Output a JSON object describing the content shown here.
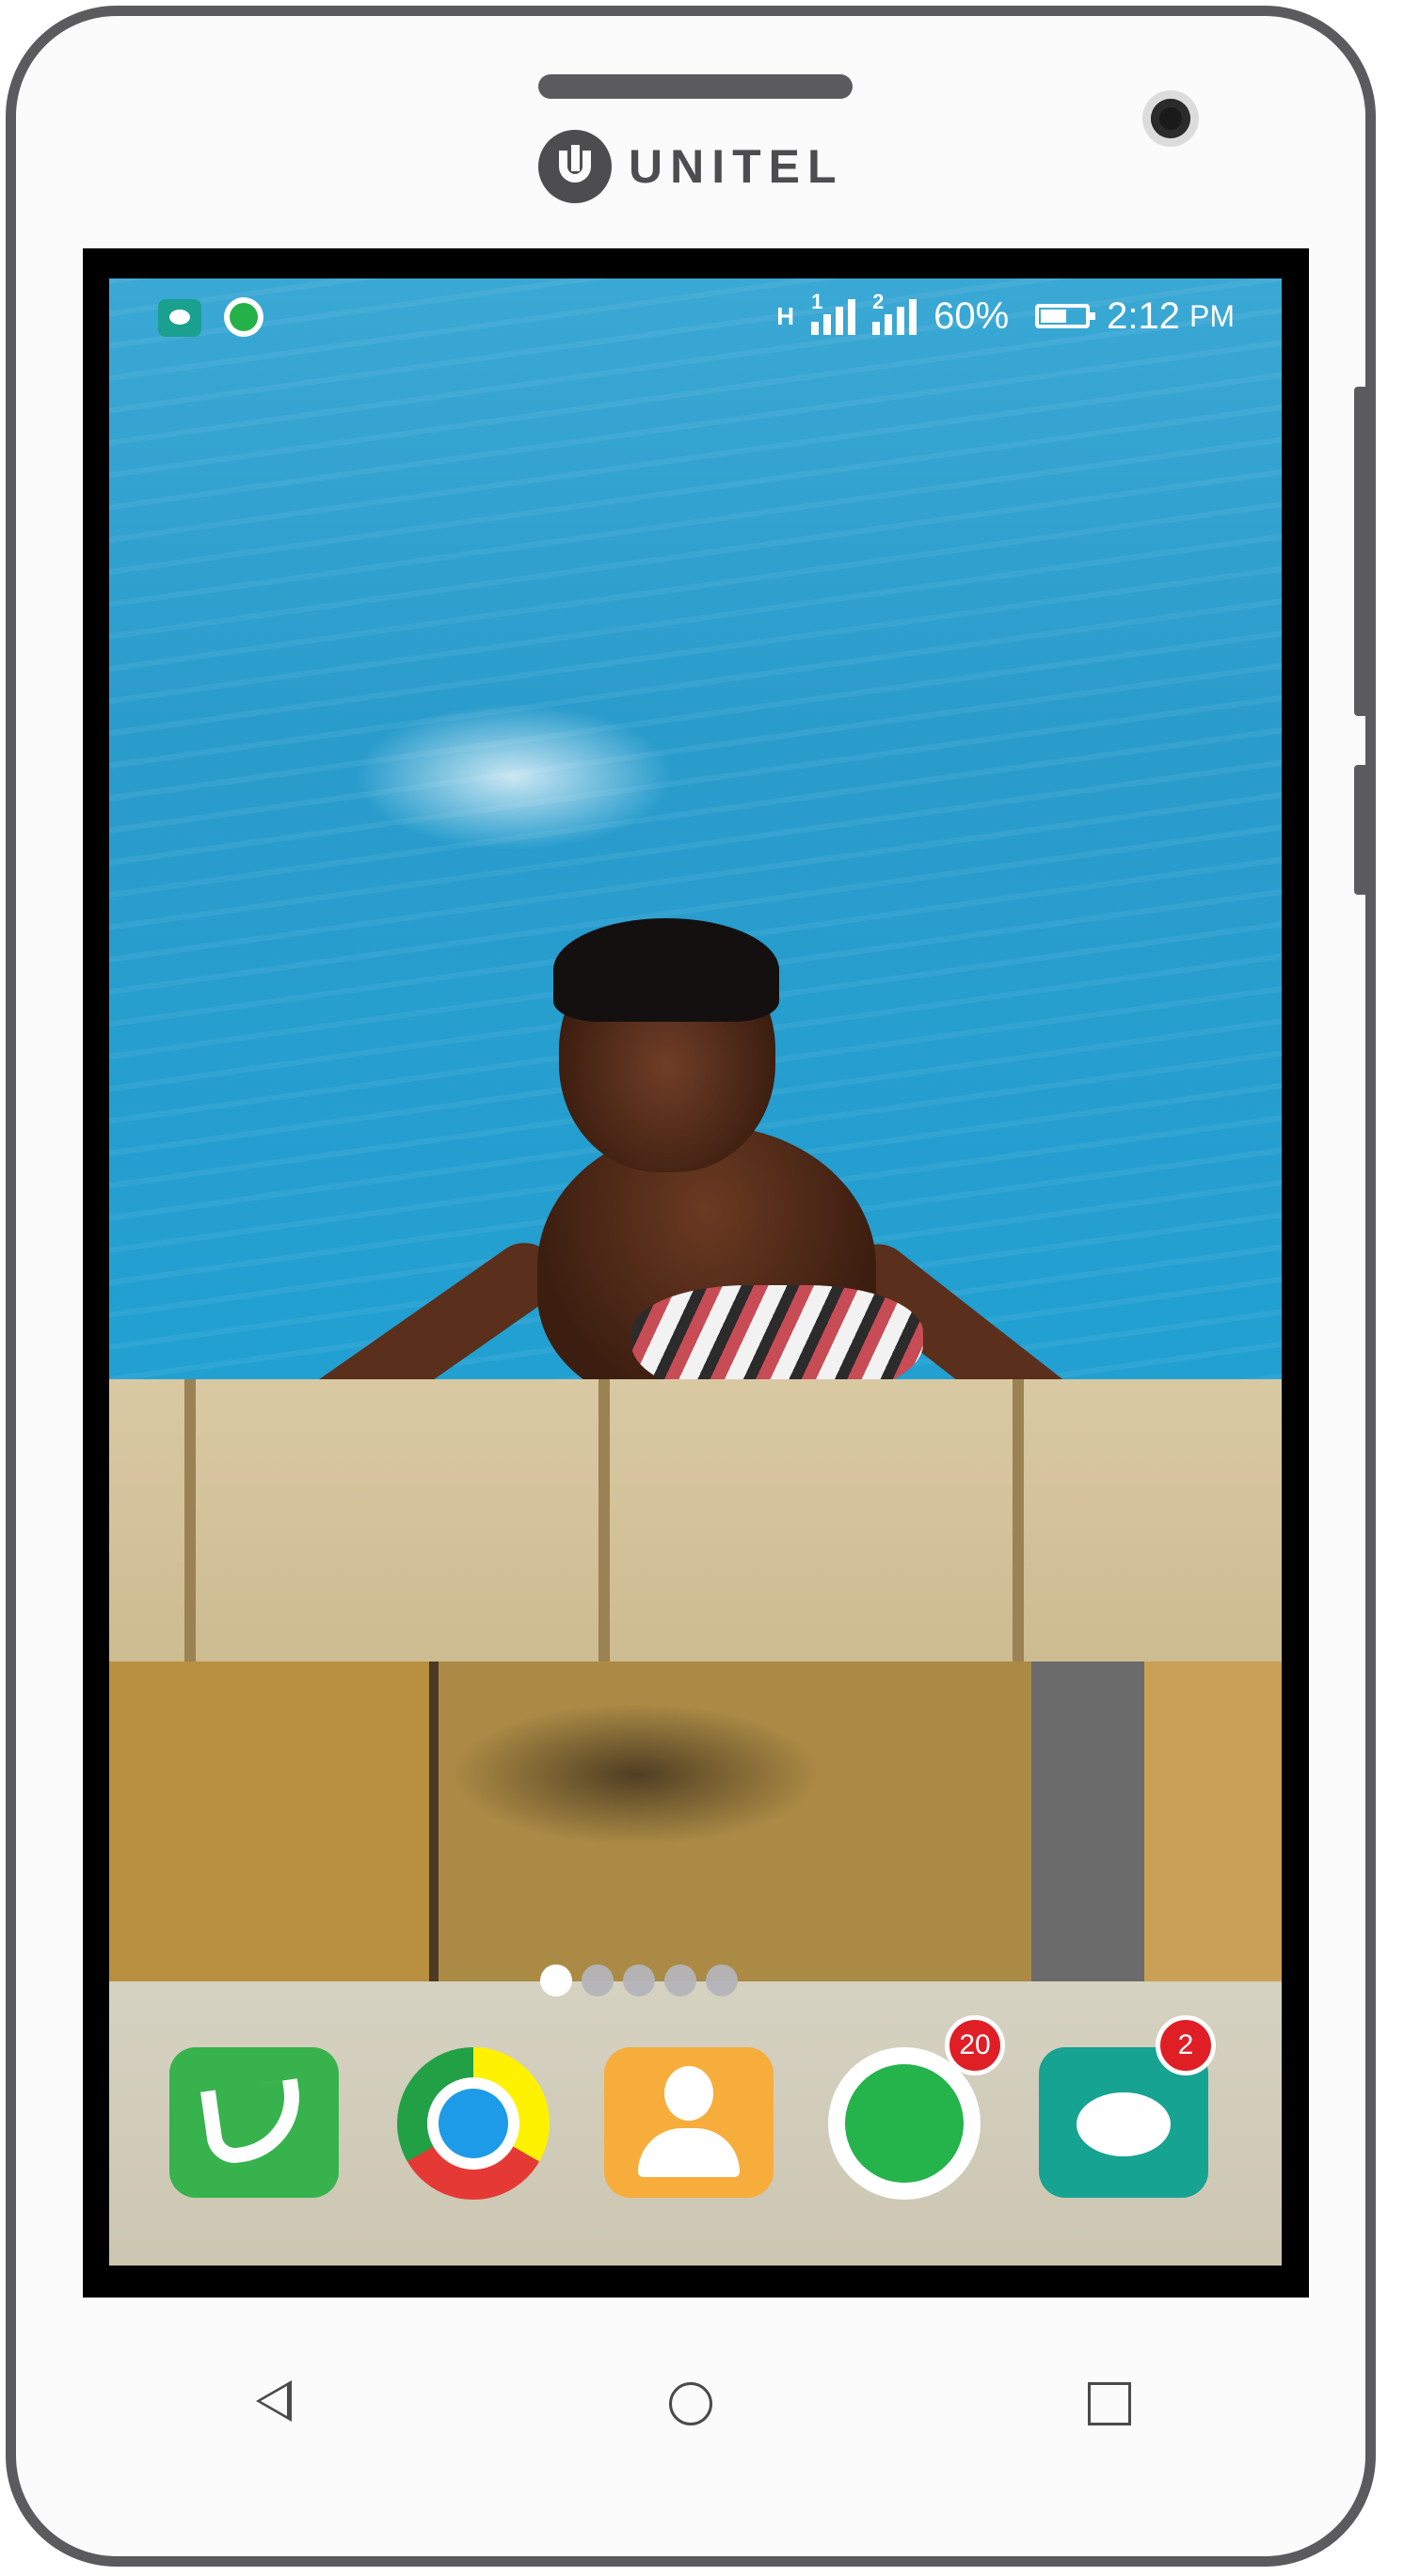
{
  "device": {
    "brand": "UNITEL"
  },
  "status_bar": {
    "notifications": [
      "message-icon",
      "whatsapp-icon"
    ],
    "network_type": "H",
    "sim1_label": "1",
    "sim2_label": "2",
    "battery_percent": "60%",
    "battery_level": 0.6,
    "time": "2:12",
    "ampm": "PM"
  },
  "home_screen": {
    "page_count": 5,
    "active_page": 1
  },
  "dock": {
    "apps": [
      {
        "name": "Phone",
        "icon": "phone-icon",
        "color": "#37b24d"
      },
      {
        "name": "Chrome",
        "icon": "chrome-icon"
      },
      {
        "name": "Contacts",
        "icon": "contacts-icon",
        "color": "#f7ad3c"
      },
      {
        "name": "WhatsApp",
        "icon": "whatsapp-icon",
        "color": "#25b34b",
        "badge": "20"
      },
      {
        "name": "Messages",
        "icon": "messages-icon",
        "color": "#17a391",
        "badge": "2"
      }
    ]
  },
  "nav_bar": {
    "buttons": [
      "back-icon",
      "home-icon",
      "recents-icon"
    ]
  }
}
